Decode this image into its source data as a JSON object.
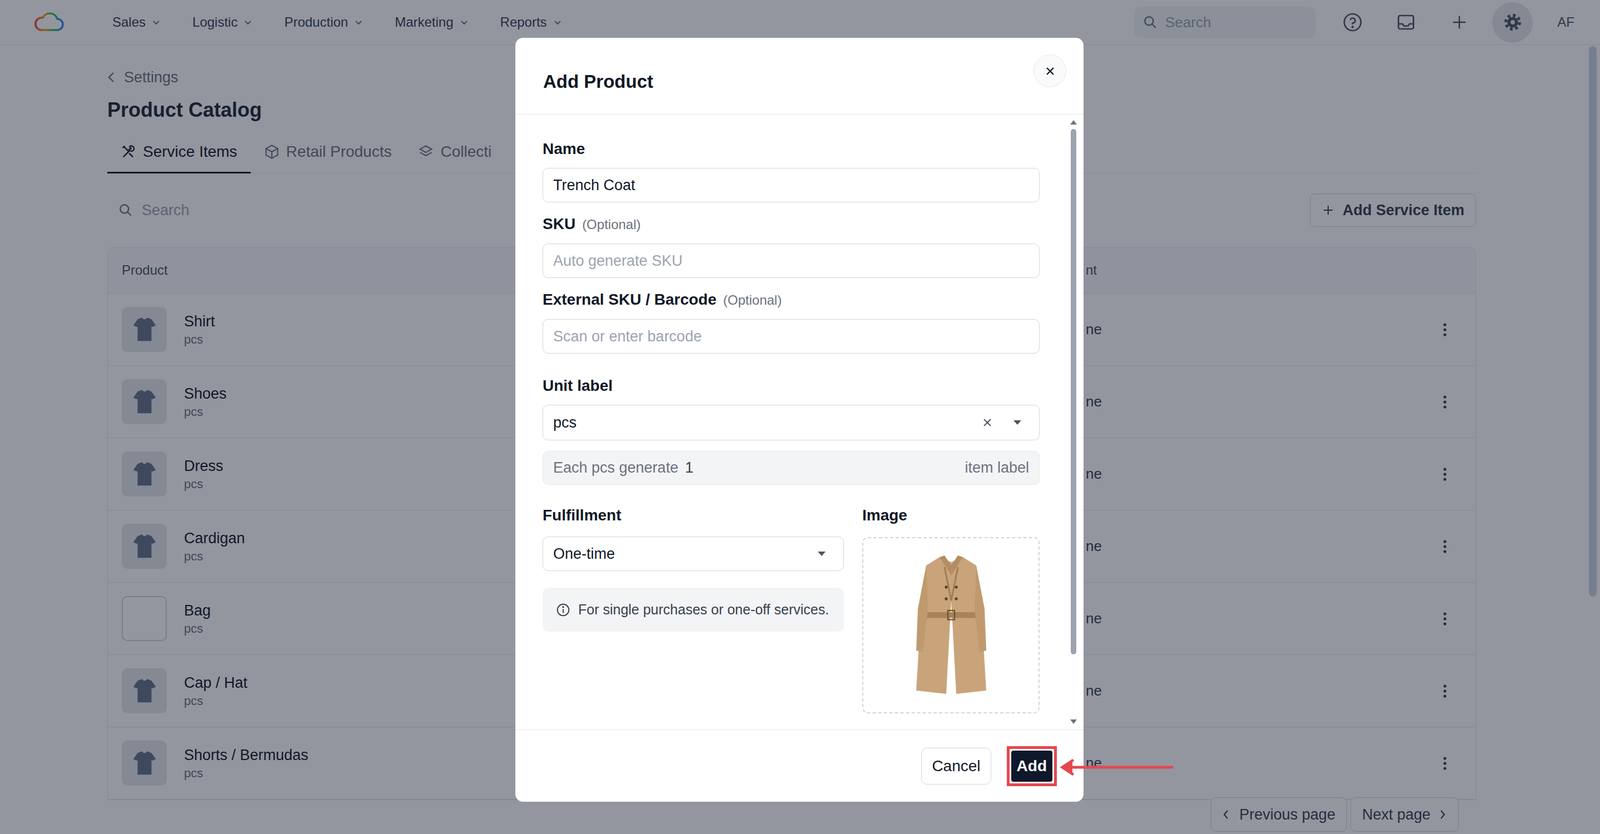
{
  "nav": {
    "items": [
      {
        "label": "Sales"
      },
      {
        "label": "Logistic"
      },
      {
        "label": "Production"
      },
      {
        "label": "Marketing"
      },
      {
        "label": "Reports"
      }
    ],
    "search": {
      "placeholder": "Search"
    },
    "settings_active": true,
    "avatar": "AF"
  },
  "page": {
    "back": "Settings",
    "title": "Product Catalog",
    "tabs": [
      {
        "label": "Service Items",
        "selected": true
      },
      {
        "label": "Retail Products",
        "selected": false
      },
      {
        "label": "Collecti",
        "selected": false
      }
    ],
    "search": {
      "placeholder": "Search"
    },
    "add_button": "Add Service Item",
    "table": {
      "columns": [
        "Product",
        "nt"
      ],
      "rows": [
        {
          "name": "Shirt",
          "unit": "pcs",
          "fulfillment": "ne",
          "has_image": true
        },
        {
          "name": "Shoes",
          "unit": "pcs",
          "fulfillment": "ne",
          "has_image": true
        },
        {
          "name": "Dress",
          "unit": "pcs",
          "fulfillment": "ne",
          "has_image": true
        },
        {
          "name": "Cardigan",
          "unit": "pcs",
          "fulfillment": "ne",
          "has_image": true
        },
        {
          "name": "Bag",
          "unit": "pcs",
          "fulfillment": "ne",
          "has_image": false
        },
        {
          "name": "Cap / Hat",
          "unit": "pcs",
          "fulfillment": "ne",
          "has_image": true
        },
        {
          "name": "Shorts / Bermudas",
          "unit": "pcs",
          "fulfillment": "ne",
          "has_image": true
        }
      ]
    },
    "pagination": {
      "previous": "Previous page",
      "next": "Next page"
    }
  },
  "modal": {
    "title": "Add Product",
    "fields": {
      "name": {
        "label": "Name",
        "value": "Trench Coat"
      },
      "sku": {
        "label": "SKU",
        "hint": "(Optional)",
        "placeholder": "Auto generate SKU"
      },
      "barcode": {
        "label": "External SKU / Barcode",
        "hint": "(Optional)",
        "placeholder": "Scan or enter barcode"
      },
      "unit": {
        "label": "Unit label",
        "value": "pcs",
        "generate": {
          "prefix": "Each pcs generate",
          "value": "1",
          "suffix": "item label"
        }
      },
      "fulfillment": {
        "label": "Fulfillment",
        "value": "One-time",
        "info": "For single purchases or one-off services."
      },
      "image": {
        "label": "Image"
      }
    },
    "buttons": [
      {
        "label": "Cancel",
        "kind": "secondary",
        "highlighted": false
      },
      {
        "label": "Add",
        "kind": "primary",
        "highlighted": true
      }
    ]
  }
}
